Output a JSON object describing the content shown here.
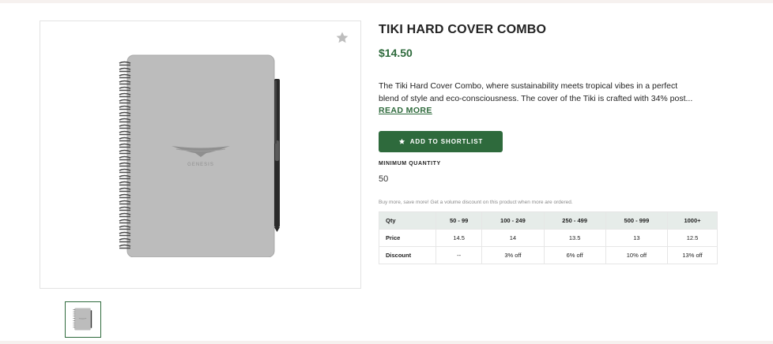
{
  "product": {
    "title": "TIKI HARD COVER COMBO",
    "price": "$14.50",
    "description_line1": "The Tiki Hard Cover Combo, where sustainability meets tropical vibes in a perfect",
    "description_line2": "blend of style and eco-consciousness. The cover of the Tiki is crafted with 34% post...",
    "read_more": "READ MORE",
    "cover_brand": "GENESIS",
    "favorite_icon": "star-icon"
  },
  "actions": {
    "shortlist_label": "ADD TO SHORTLIST",
    "shortlist_icon": "star-icon"
  },
  "minimum_quantity": {
    "label": "MINIMUM QUANTITY",
    "value": "50"
  },
  "pricing": {
    "note": "Buy more, save more! Get a volume discount on this product when more are ordered.",
    "headers": [
      "Qty",
      "50 - 99",
      "100 - 249",
      "250 - 499",
      "500 - 999",
      "1000+"
    ],
    "price_row": [
      "Price",
      "14.5",
      "14",
      "13.5",
      "13",
      "12.5"
    ],
    "discount_row": [
      "Discount",
      "--",
      "3% off",
      "6% off",
      "10% off",
      "13% off"
    ]
  },
  "colors": {
    "accent": "#2e6a3c",
    "table_header_bg": "#e6ece9",
    "page_bg": "#f6f1ef"
  }
}
